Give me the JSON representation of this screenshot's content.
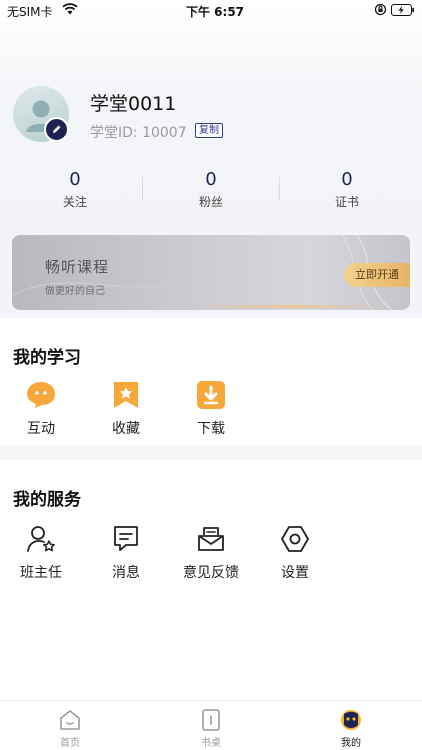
{
  "status_bar": {
    "carrier": "无SIM卡",
    "time": "下午 6:57"
  },
  "profile": {
    "username": "学堂0011",
    "user_id": "学堂ID: 10007",
    "copy_label": "复制"
  },
  "stats": [
    {
      "value": "0",
      "label": "关注"
    },
    {
      "value": "0",
      "label": "粉丝"
    },
    {
      "value": "0",
      "label": "证书"
    }
  ],
  "banner": {
    "title": "畅听课程",
    "subtitle": "做更好的自己",
    "button": "立即开通"
  },
  "my_learning": {
    "title": "我的学习",
    "items": [
      {
        "label": "互动",
        "icon": "chat-bubble-icon"
      },
      {
        "label": "收藏",
        "icon": "bookmark-star-icon"
      },
      {
        "label": "下载",
        "icon": "download-icon"
      }
    ]
  },
  "my_services": {
    "title": "我的服务",
    "items": [
      {
        "label": "班主任",
        "icon": "user-star-icon"
      },
      {
        "label": "消息",
        "icon": "message-icon"
      },
      {
        "label": "意见反馈",
        "icon": "feedback-icon"
      },
      {
        "label": "设置",
        "icon": "settings-hex-icon"
      }
    ]
  },
  "tab_bar": {
    "items": [
      {
        "label": "首页",
        "active": false
      },
      {
        "label": "书桌",
        "active": false
      },
      {
        "label": "我的",
        "active": true
      }
    ]
  },
  "colors": {
    "accent_navy": "#1e2452",
    "orange": "#f7a83a",
    "gold_button": "#e8b464"
  }
}
